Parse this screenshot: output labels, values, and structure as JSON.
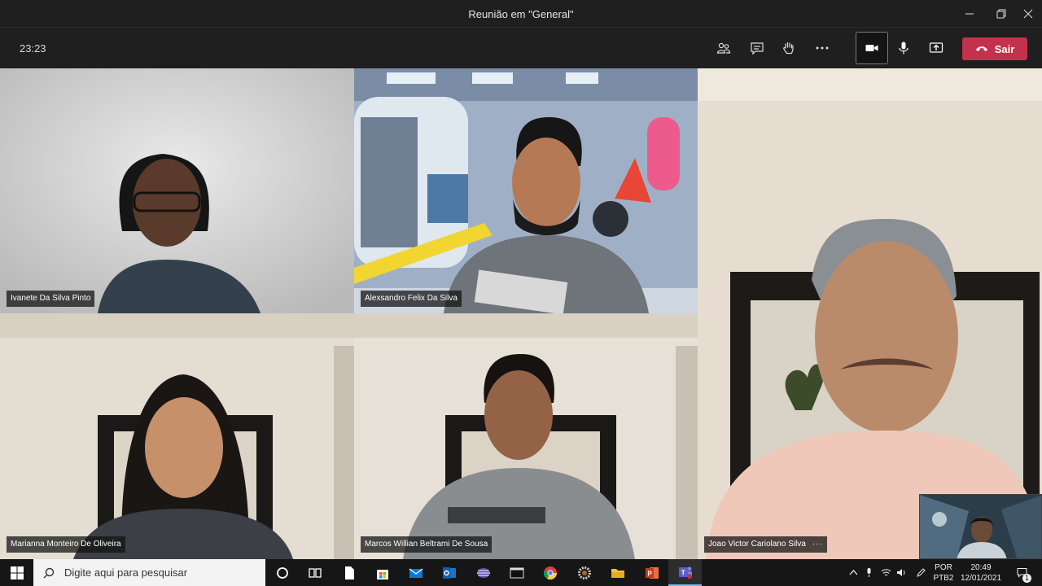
{
  "window": {
    "title": "Reunião em \"General\""
  },
  "controls": {
    "timer": "23:23",
    "leave_label": "Sair"
  },
  "participants": [
    {
      "name": "Ivanete Da Silva Pinto"
    },
    {
      "name": "Alexsandro Felix Da Silva"
    },
    {
      "name": "Joao Victor Cariolano Silva",
      "more": "···"
    },
    {
      "name": "Marianna Monteiro De Oliveira"
    },
    {
      "name": "Marcos Willian Beltrami De Sousa"
    }
  ],
  "taskbar": {
    "search_placeholder": "Digite aqui para pesquisar",
    "language_1": "POR",
    "language_2": "PTB2",
    "time": "20:49",
    "date": "12/01/2021",
    "notification_count": "1"
  },
  "colors": {
    "leave": "#c4314b",
    "teams_purple": "#5b5fc7",
    "background": "#1f1f1f"
  }
}
